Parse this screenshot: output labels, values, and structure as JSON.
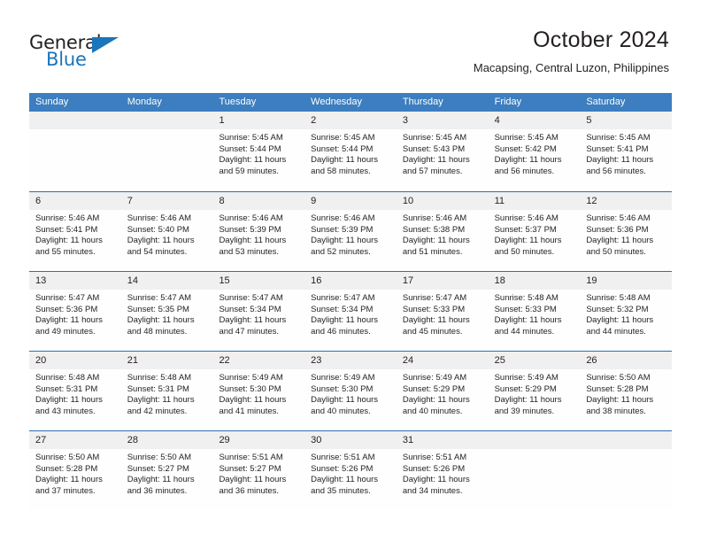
{
  "brand": {
    "name_part1": "General",
    "name_part2": "Blue",
    "colors": {
      "black": "#231f20",
      "blue": "#1b75bb"
    }
  },
  "header": {
    "title": "October 2024",
    "subtitle": "Macapsing, Central Luzon, Philippines"
  },
  "calendar": {
    "header_bg": "#3c7ebf",
    "row_separator": "#2f6fad",
    "day_band_bg": "#f0f0f0",
    "weekdays": [
      "Sunday",
      "Monday",
      "Tuesday",
      "Wednesday",
      "Thursday",
      "Friday",
      "Saturday"
    ],
    "weeks": [
      [
        {
          "day": ""
        },
        {
          "day": ""
        },
        {
          "day": "1",
          "sunrise": "Sunrise: 5:45 AM",
          "sunset": "Sunset: 5:44 PM",
          "daylight": "Daylight: 11 hours and 59 minutes."
        },
        {
          "day": "2",
          "sunrise": "Sunrise: 5:45 AM",
          "sunset": "Sunset: 5:44 PM",
          "daylight": "Daylight: 11 hours and 58 minutes."
        },
        {
          "day": "3",
          "sunrise": "Sunrise: 5:45 AM",
          "sunset": "Sunset: 5:43 PM",
          "daylight": "Daylight: 11 hours and 57 minutes."
        },
        {
          "day": "4",
          "sunrise": "Sunrise: 5:45 AM",
          "sunset": "Sunset: 5:42 PM",
          "daylight": "Daylight: 11 hours and 56 minutes."
        },
        {
          "day": "5",
          "sunrise": "Sunrise: 5:45 AM",
          "sunset": "Sunset: 5:41 PM",
          "daylight": "Daylight: 11 hours and 56 minutes."
        }
      ],
      [
        {
          "day": "6",
          "sunrise": "Sunrise: 5:46 AM",
          "sunset": "Sunset: 5:41 PM",
          "daylight": "Daylight: 11 hours and 55 minutes."
        },
        {
          "day": "7",
          "sunrise": "Sunrise: 5:46 AM",
          "sunset": "Sunset: 5:40 PM",
          "daylight": "Daylight: 11 hours and 54 minutes."
        },
        {
          "day": "8",
          "sunrise": "Sunrise: 5:46 AM",
          "sunset": "Sunset: 5:39 PM",
          "daylight": "Daylight: 11 hours and 53 minutes."
        },
        {
          "day": "9",
          "sunrise": "Sunrise: 5:46 AM",
          "sunset": "Sunset: 5:39 PM",
          "daylight": "Daylight: 11 hours and 52 minutes."
        },
        {
          "day": "10",
          "sunrise": "Sunrise: 5:46 AM",
          "sunset": "Sunset: 5:38 PM",
          "daylight": "Daylight: 11 hours and 51 minutes."
        },
        {
          "day": "11",
          "sunrise": "Sunrise: 5:46 AM",
          "sunset": "Sunset: 5:37 PM",
          "daylight": "Daylight: 11 hours and 50 minutes."
        },
        {
          "day": "12",
          "sunrise": "Sunrise: 5:46 AM",
          "sunset": "Sunset: 5:36 PM",
          "daylight": "Daylight: 11 hours and 50 minutes."
        }
      ],
      [
        {
          "day": "13",
          "sunrise": "Sunrise: 5:47 AM",
          "sunset": "Sunset: 5:36 PM",
          "daylight": "Daylight: 11 hours and 49 minutes."
        },
        {
          "day": "14",
          "sunrise": "Sunrise: 5:47 AM",
          "sunset": "Sunset: 5:35 PM",
          "daylight": "Daylight: 11 hours and 48 minutes."
        },
        {
          "day": "15",
          "sunrise": "Sunrise: 5:47 AM",
          "sunset": "Sunset: 5:34 PM",
          "daylight": "Daylight: 11 hours and 47 minutes."
        },
        {
          "day": "16",
          "sunrise": "Sunrise: 5:47 AM",
          "sunset": "Sunset: 5:34 PM",
          "daylight": "Daylight: 11 hours and 46 minutes."
        },
        {
          "day": "17",
          "sunrise": "Sunrise: 5:47 AM",
          "sunset": "Sunset: 5:33 PM",
          "daylight": "Daylight: 11 hours and 45 minutes."
        },
        {
          "day": "18",
          "sunrise": "Sunrise: 5:48 AM",
          "sunset": "Sunset: 5:33 PM",
          "daylight": "Daylight: 11 hours and 44 minutes."
        },
        {
          "day": "19",
          "sunrise": "Sunrise: 5:48 AM",
          "sunset": "Sunset: 5:32 PM",
          "daylight": "Daylight: 11 hours and 44 minutes."
        }
      ],
      [
        {
          "day": "20",
          "sunrise": "Sunrise: 5:48 AM",
          "sunset": "Sunset: 5:31 PM",
          "daylight": "Daylight: 11 hours and 43 minutes."
        },
        {
          "day": "21",
          "sunrise": "Sunrise: 5:48 AM",
          "sunset": "Sunset: 5:31 PM",
          "daylight": "Daylight: 11 hours and 42 minutes."
        },
        {
          "day": "22",
          "sunrise": "Sunrise: 5:49 AM",
          "sunset": "Sunset: 5:30 PM",
          "daylight": "Daylight: 11 hours and 41 minutes."
        },
        {
          "day": "23",
          "sunrise": "Sunrise: 5:49 AM",
          "sunset": "Sunset: 5:30 PM",
          "daylight": "Daylight: 11 hours and 40 minutes."
        },
        {
          "day": "24",
          "sunrise": "Sunrise: 5:49 AM",
          "sunset": "Sunset: 5:29 PM",
          "daylight": "Daylight: 11 hours and 40 minutes."
        },
        {
          "day": "25",
          "sunrise": "Sunrise: 5:49 AM",
          "sunset": "Sunset: 5:29 PM",
          "daylight": "Daylight: 11 hours and 39 minutes."
        },
        {
          "day": "26",
          "sunrise": "Sunrise: 5:50 AM",
          "sunset": "Sunset: 5:28 PM",
          "daylight": "Daylight: 11 hours and 38 minutes."
        }
      ],
      [
        {
          "day": "27",
          "sunrise": "Sunrise: 5:50 AM",
          "sunset": "Sunset: 5:28 PM",
          "daylight": "Daylight: 11 hours and 37 minutes."
        },
        {
          "day": "28",
          "sunrise": "Sunrise: 5:50 AM",
          "sunset": "Sunset: 5:27 PM",
          "daylight": "Daylight: 11 hours and 36 minutes."
        },
        {
          "day": "29",
          "sunrise": "Sunrise: 5:51 AM",
          "sunset": "Sunset: 5:27 PM",
          "daylight": "Daylight: 11 hours and 36 minutes."
        },
        {
          "day": "30",
          "sunrise": "Sunrise: 5:51 AM",
          "sunset": "Sunset: 5:26 PM",
          "daylight": "Daylight: 11 hours and 35 minutes."
        },
        {
          "day": "31",
          "sunrise": "Sunrise: 5:51 AM",
          "sunset": "Sunset: 5:26 PM",
          "daylight": "Daylight: 11 hours and 34 minutes."
        },
        {
          "day": ""
        },
        {
          "day": ""
        }
      ]
    ]
  }
}
